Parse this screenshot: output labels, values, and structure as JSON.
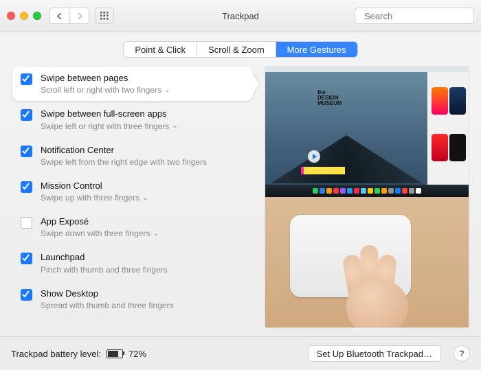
{
  "header": {
    "title": "Trackpad",
    "search_placeholder": "Search"
  },
  "tabs": [
    {
      "id": "point",
      "label": "Point & Click"
    },
    {
      "id": "scroll",
      "label": "Scroll & Zoom"
    },
    {
      "id": "gestures",
      "label": "More Gestures"
    }
  ],
  "active_tab": "gestures",
  "options": [
    {
      "id": "swipe-pages",
      "title": "Swipe between pages",
      "desc": "Scroll left or right with two fingers",
      "checked": true,
      "dropdown": true,
      "selected": true
    },
    {
      "id": "swipe-apps",
      "title": "Swipe between full-screen apps",
      "desc": "Swipe left or right with three fingers",
      "checked": true,
      "dropdown": true,
      "selected": false
    },
    {
      "id": "notif",
      "title": "Notification Center",
      "desc": "Swipe left from the right edge with two fingers",
      "checked": true,
      "dropdown": false,
      "selected": false
    },
    {
      "id": "mission",
      "title": "Mission Control",
      "desc": "Swipe up with three fingers",
      "checked": true,
      "dropdown": true,
      "selected": false
    },
    {
      "id": "expose",
      "title": "App Exposé",
      "desc": "Swipe down with three fingers",
      "checked": false,
      "dropdown": true,
      "selected": false
    },
    {
      "id": "launchpad",
      "title": "Launchpad",
      "desc": "Pinch with thumb and three fingers",
      "checked": true,
      "dropdown": false,
      "selected": false
    },
    {
      "id": "desktop",
      "title": "Show Desktop",
      "desc": "Spread with thumb and three fingers",
      "checked": true,
      "dropdown": false,
      "selected": false
    }
  ],
  "footer": {
    "battery_label": "Trackpad battery level:",
    "battery_pct": "72%",
    "setup_label": "Set Up Bluetooth Trackpad…",
    "help_label": "?"
  },
  "preview": {
    "design_museum": "the\nDESIGN\nMUSEUM"
  }
}
